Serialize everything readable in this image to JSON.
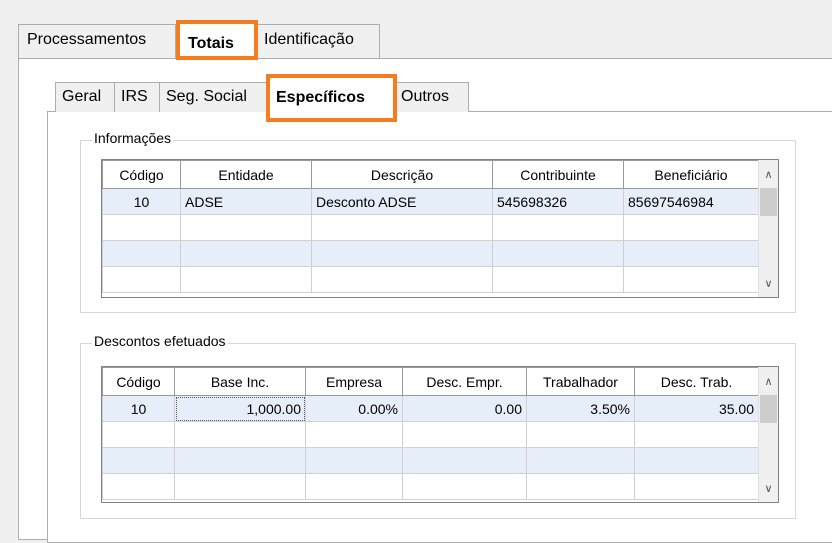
{
  "top_tabs": [
    {
      "label": "Processamentos"
    },
    {
      "label": "Totais"
    },
    {
      "label": "Identificação"
    }
  ],
  "sub_tabs": [
    {
      "label": "Geral"
    },
    {
      "label": "IRS"
    },
    {
      "label": "Seg. Social"
    },
    {
      "label": "Específicos"
    },
    {
      "label": "Outros"
    }
  ],
  "highlight_color": "#f57c1f",
  "informacoes": {
    "title": "Informações",
    "headers": [
      "Código",
      "Entidade",
      "Descrição",
      "Contribuinte",
      "Beneficiário"
    ],
    "rows": [
      [
        "10",
        "ADSE",
        "Desconto ADSE",
        "545698326",
        "85697546984"
      ]
    ]
  },
  "descontos": {
    "title": "Descontos efetuados",
    "headers": [
      "Código",
      "Base Inc.",
      "Empresa",
      "Desc. Empr.",
      "Trabalhador",
      "Desc. Trab."
    ],
    "rows": [
      [
        "10",
        "1,000.00",
        "0.00%",
        "0.00",
        "3.50%",
        "35.00"
      ]
    ]
  }
}
